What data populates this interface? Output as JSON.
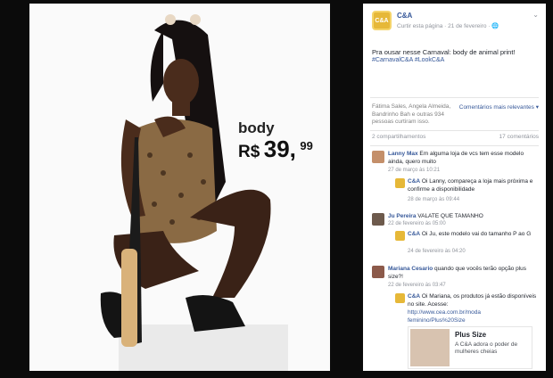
{
  "photo": {
    "product": "body",
    "currency": "R$",
    "price_int": "39,",
    "price_cents": "99"
  },
  "post": {
    "page_name": "C&A",
    "logo_text": "C&A",
    "meta": "Curtir esta página · 21 de fevereiro · ",
    "text": "Pra ousar nesse Carnaval: body de animal print!",
    "hashtags": "#CarnavalC&A #LookC&A"
  },
  "likes": {
    "text": "Fátima Sales, Angela Almeida, Bandrinho Bah e outras 934 pessoas curtiram isso.",
    "sort": "Comentários mais relevantes ▾"
  },
  "counts": {
    "shares": "2 compartilhamentos",
    "comments": "17 comentários"
  },
  "comments": [
    {
      "author": "Lanny Max",
      "text": "Em alguma loja de vcs tem esse modelo ainda, quero muito",
      "time": "27 de março às 10:21",
      "reply_author": "C&A",
      "reply_text": "Oi Lanny, compareça a loja mais próxima e confirme a disponibilidade",
      "reply_time": "28 de março às 09:44"
    },
    {
      "author": "Ju Pereira",
      "text": "VALATE QUE TAMANHO",
      "time": "22 de fevereiro às 05:00",
      "reply_author": "C&A",
      "reply_text": "Oi Ju, este modelo vai do tamanho P ao G",
      "reply_time": "24 de fevereiro às 04:20"
    },
    {
      "author": "Mariana Cesario",
      "text": "quando que vocês terão opção plus size?!",
      "time": "22 de fevereiro às 03:47",
      "reply_author": "C&A",
      "reply_text": "Oi Mariana, os produtos já estão disponíveis no site. Acesse:",
      "reply_link": "http://www.cea.com.br/moda feminino/Plus%20Size",
      "preview_title": "Plus Size",
      "preview_text": "A C&A adora o poder de mulheres cheias"
    }
  ],
  "colors": {
    "fb_blue": "#365899",
    "muted": "#90949c",
    "logo": "#e6b838"
  }
}
